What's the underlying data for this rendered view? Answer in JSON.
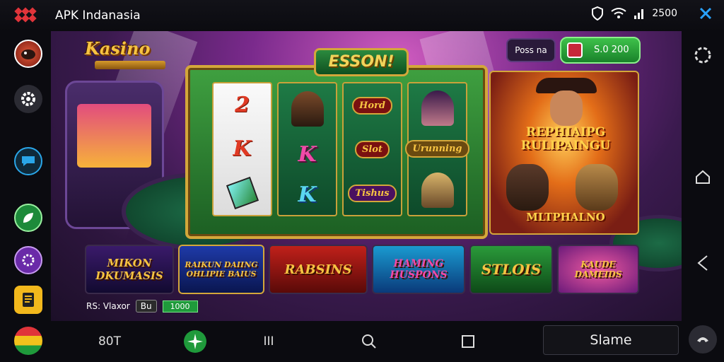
{
  "status_bar": {
    "app_title": "APK Indanasia",
    "count": "2500",
    "icons": [
      "shield-icon",
      "wifi-icon",
      "signal-icon",
      "close-icon"
    ]
  },
  "left_rail": {
    "items": [
      "avatar",
      "settings-icon",
      "chat-icon",
      "leaf-icon",
      "gear-badge-icon",
      "document-icon",
      "flag-icon"
    ]
  },
  "right_rail": {
    "items": [
      "menu-icon",
      "home-icon",
      "back-icon",
      "phone-icon"
    ]
  },
  "game": {
    "logo": "Kasino",
    "slot_title": "ESSON!",
    "hud_label": "Poss na",
    "balance": "S.0 200",
    "reels": [
      {
        "symbols": [
          "2",
          "K",
          "cube"
        ]
      },
      {
        "symbols": [
          "portrait",
          "K",
          "K"
        ]
      },
      {
        "symbols": [
          "Hord",
          "Slot",
          "Tishus"
        ]
      },
      {
        "symbols": [
          "portrait",
          "Urunning",
          "portrait"
        ]
      }
    ],
    "promo": {
      "title": "REPHIAIPG RULIPAINGU",
      "subtitle": "MLTPHALNO"
    },
    "tiles": [
      {
        "label": "MIKON DKUMASIS"
      },
      {
        "label": "RAIKUN DAIING OHLIPIE BAIUS"
      },
      {
        "label": "RABSINS"
      },
      {
        "label": "HAMING HUSPONS"
      },
      {
        "label": "STLOIS"
      },
      {
        "label": "KAUDE DAMEIDS"
      }
    ],
    "tile_footer": {
      "text": "RS: Vlaxor",
      "chip_grey": "Bu",
      "chip_green": "1000"
    }
  },
  "bottom_nav": {
    "item1": "80T",
    "item2_icon": "spark-icon",
    "item3": "III",
    "item4_icon": "search-icon",
    "item5_icon": "square-icon",
    "button": "Slame"
  },
  "colors": {
    "accent_gold": "#d4a73a",
    "balance_green": "#3ec14a",
    "background": "#0d0d14"
  }
}
